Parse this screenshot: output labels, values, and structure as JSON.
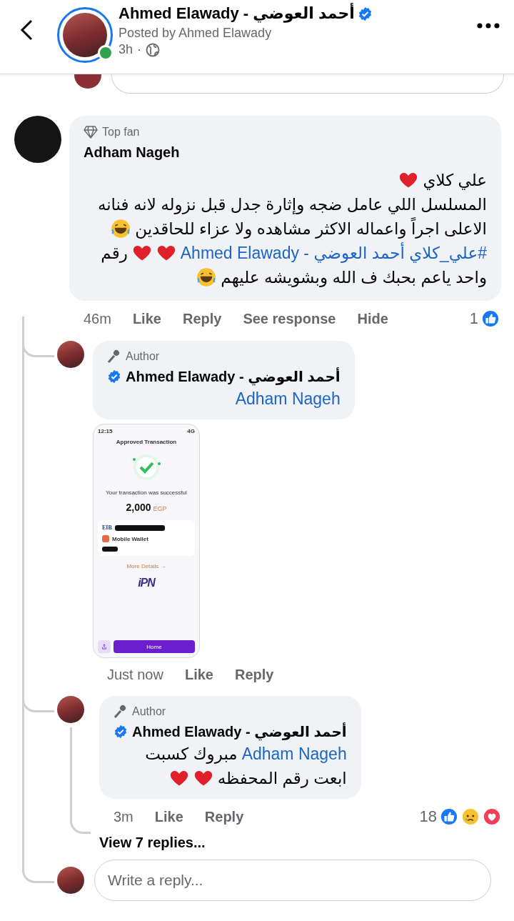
{
  "header": {
    "name": "Ahmed Elawady - أحمد العوضي",
    "verified": true,
    "online": true,
    "posted_by": "Posted by Ahmed Elawady",
    "time": "3h",
    "separator": "·"
  },
  "comment": {
    "badge": "Top fan",
    "author": "Adham Nageh",
    "verified": false,
    "lines": [
      {
        "rtl": true,
        "segments": [
          {
            "kind": "text",
            "text": "علي كلاي"
          },
          {
            "kind": "heart"
          }
        ]
      },
      {
        "segments": [
          {
            "kind": "text",
            "text": "المسلسل اللي عامل ضجه وإثارة جدل قبل نزوله لانه فنانه"
          }
        ]
      },
      {
        "rtl": true,
        "segments": [
          {
            "kind": "text",
            "text": "الاعلى اجراً واعماله الاكثر مشاهده ولا عزاء للحاقدين"
          },
          {
            "kind": "laugh"
          }
        ]
      },
      {
        "rtl": true,
        "segments": [
          {
            "kind": "link",
            "text": "#علي_كلاي أحمد العوضي - Ahmed Elawady"
          },
          {
            "kind": "heart"
          },
          {
            "kind": "heart"
          },
          {
            "kind": "text",
            "text": "رقم"
          }
        ]
      },
      {
        "rtl": true,
        "segments": [
          {
            "kind": "text",
            "text": "واحد ياعم بحبك ف الله وبشويشه عليهم"
          },
          {
            "kind": "laugh"
          }
        ]
      }
    ],
    "time": "46m",
    "actions": [
      "Like",
      "Reply",
      "See response",
      "Hide"
    ],
    "reaction_count": "1",
    "reactions": [
      {
        "kind": "like"
      }
    ]
  },
  "replies": [
    {
      "badge": "Author",
      "author": "Ahmed Elawady - أحمد العوضي",
      "verified": true,
      "lines": [
        {
          "segments": [
            {
              "kind": "link",
              "text": "Adham Nageh"
            }
          ]
        }
      ],
      "attachment": {
        "status_time": "12:15",
        "network": "4G",
        "title": "Approved Transaction",
        "message": "Your transaction was successful",
        "amount": "2,000",
        "currency": "EGP",
        "bank_logo": "EIB",
        "wallet_label": "Mobile Wallet",
        "details_link": "More Details →",
        "logo": "iPN",
        "button": "Home"
      },
      "time": "Just now",
      "actions": [
        "Like",
        "Reply"
      ]
    },
    {
      "badge": "Author",
      "author": "Ahmed Elawady - أحمد العوضي",
      "verified": true,
      "lines": [
        {
          "rtl": false,
          "segments": [
            {
              "kind": "text",
              "text": "مبروك كسبت"
            },
            {
              "kind": "link",
              "text": "Adham Nageh"
            }
          ]
        },
        {
          "rtl": true,
          "segments": [
            {
              "kind": "text",
              "text": "ابعت رقم المحفظه"
            },
            {
              "kind": "heart"
            },
            {
              "kind": "heart"
            }
          ]
        }
      ],
      "time": "3m",
      "actions": [
        "Like",
        "Reply"
      ],
      "reaction_count": "18",
      "reactions": [
        {
          "kind": "like"
        },
        {
          "kind": "sad"
        },
        {
          "kind": "love"
        }
      ],
      "view_replies": "View 7 replies..."
    }
  ],
  "reply_box": {
    "placeholder": "Write a reply..."
  }
}
